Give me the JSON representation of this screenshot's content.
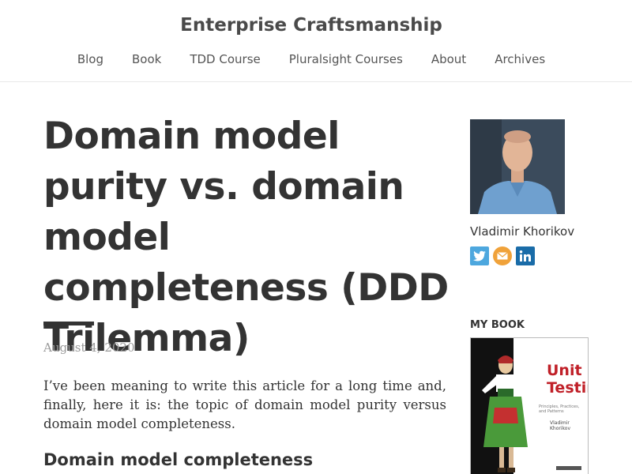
{
  "site": {
    "title": "Enterprise Craftsmanship"
  },
  "nav": {
    "items": [
      "Blog",
      "Book",
      "TDD Course",
      "Pluralsight Courses",
      "About",
      "Archives"
    ]
  },
  "post": {
    "title": "Domain model purity vs. domain model completeness (DDD Trilemma)",
    "date": "August 4, 2020",
    "intro": "I’ve been meaning to write this article for a long time and, finally, here it is: the topic of domain model purity versus domain model completeness.",
    "section_heading": "Domain model completeness"
  },
  "sidebar": {
    "author_name": "Vladimir Khorikov",
    "social_icons": [
      "twitter-icon",
      "email-icon",
      "linkedin-icon"
    ],
    "book_heading": "MY BOOK",
    "book": {
      "title_line1": "Unit",
      "title_line2": "Testing",
      "subtitle": "Principles, Practices, and Patterns",
      "author": "Vladimir Khorikov"
    }
  },
  "colors": {
    "twitter": "#4da7de",
    "email": "#f0a23a",
    "linkedin": "#1a6ca8",
    "book_title": "#c02028"
  }
}
